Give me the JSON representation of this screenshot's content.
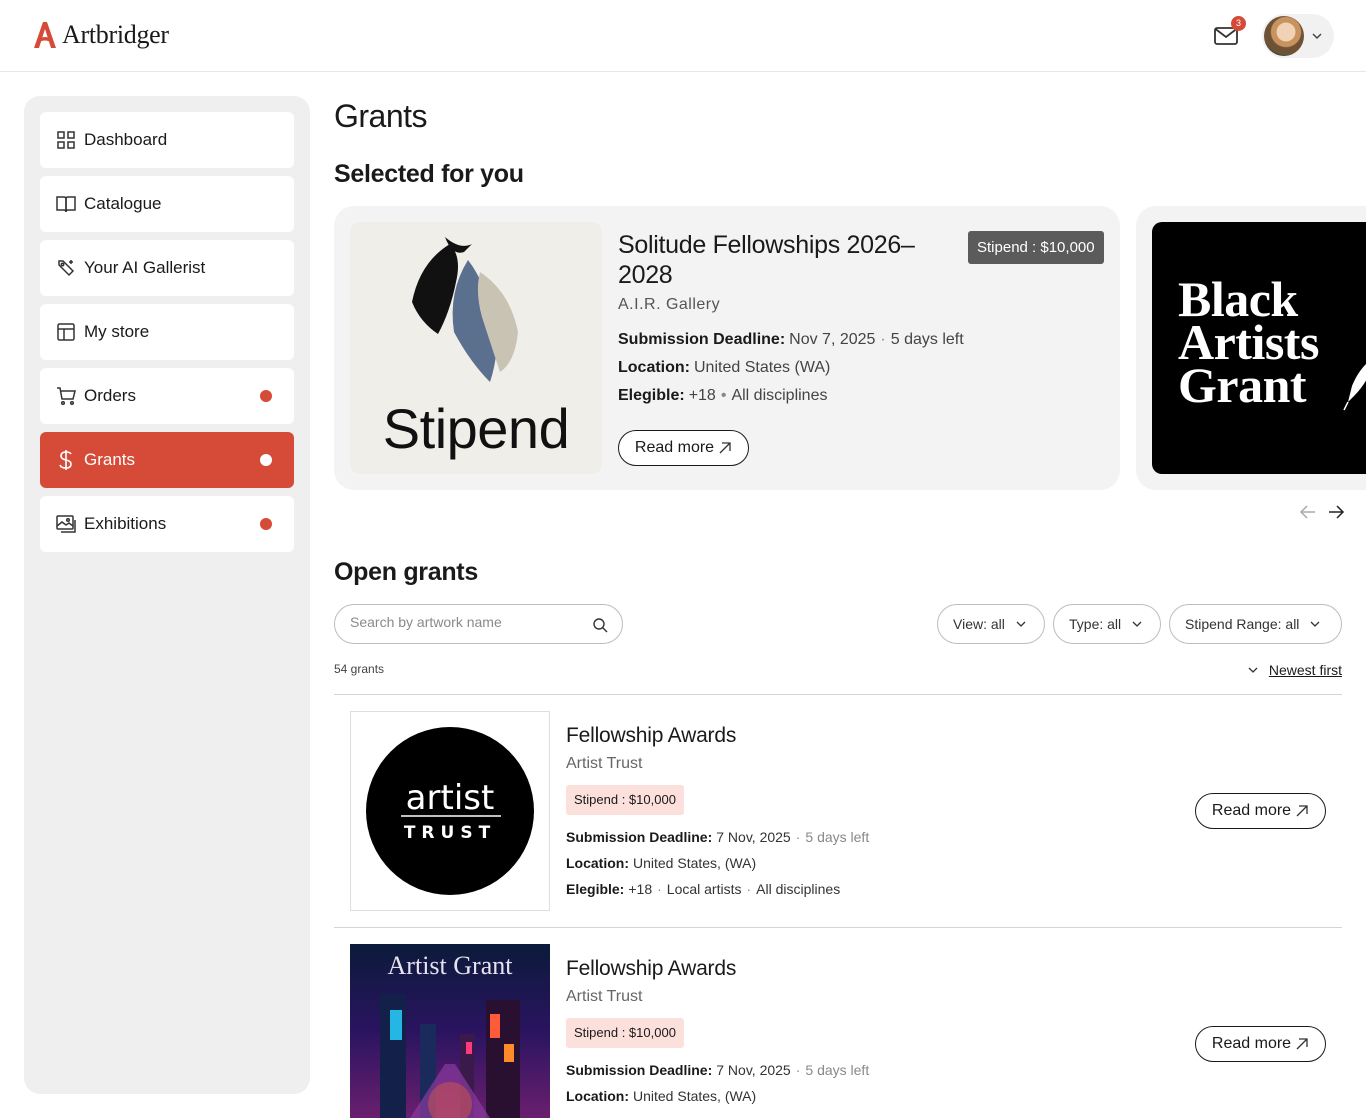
{
  "header": {
    "brand": "Artbridger",
    "notification_count": "3",
    "colors": {
      "accent": "#d64b38"
    }
  },
  "sidebar": {
    "items": [
      {
        "label": "Dashboard",
        "icon": "grid-icon"
      },
      {
        "label": "Catalogue",
        "icon": "book-icon"
      },
      {
        "label": "Your AI Gallerist",
        "icon": "sparkle-tag-icon"
      },
      {
        "label": "My store",
        "icon": "store-layout-icon"
      },
      {
        "label": "Orders",
        "icon": "cart-icon",
        "has_dot": true
      },
      {
        "label": "Grants",
        "icon": "dollar-icon",
        "has_dot": true,
        "active": true
      },
      {
        "label": "Exhibitions",
        "icon": "image-gallery-icon",
        "has_dot": true
      }
    ]
  },
  "main": {
    "title": "Grants",
    "selected_title": "Selected for you",
    "featured": {
      "image_word": "Stipend",
      "title": "Solitude Fellowships 2026–2028",
      "badge": "Stipend : $10,000",
      "org": "A.I.R. Gallery",
      "deadline_label": "Submission Deadline:",
      "deadline_value": "Nov 7, 2025",
      "deadline_left": "5 days left",
      "location_label": "Location:",
      "location_value": "United States (WA)",
      "eligible_label": "Elegible:",
      "eligible_age": "+18",
      "eligible_disc": "All disciplines",
      "read_more": "Read more"
    },
    "featured_next": {
      "image_line1": "Black",
      "image_line2": "Artists",
      "image_line3": "Grant"
    },
    "open_title": "Open grants",
    "search": {
      "placeholder": "Search by artwork name"
    },
    "filters": {
      "view": "View: all",
      "type": "Type: all",
      "stipend": "Stipend Range: all"
    },
    "count": "54 grants",
    "sort": "Newest first",
    "grants": [
      {
        "image_line1": "artist",
        "image_line2": "TRUST",
        "title": "Fellowship Awards",
        "org": "Artist Trust",
        "badge": "Stipend : $10,000",
        "deadline_label": "Submission Deadline:",
        "deadline_value": "7 Nov, 2025",
        "deadline_left": "5 days left",
        "location_label": "Location:",
        "location_value": "United States, (WA)",
        "eligible_label": "Elegible:",
        "eligible_age": "+18",
        "eligible_local": "Local artists",
        "eligible_disc": "All disciplines",
        "read_more": "Read more"
      },
      {
        "image_title": "Artist Grant",
        "title": "Fellowship Awards",
        "org": "Artist Trust",
        "badge": "Stipend : $10,000",
        "deadline_label": "Submission Deadline:",
        "deadline_value": "7 Nov, 2025",
        "deadline_left": "5 days left",
        "location_label": "Location:",
        "location_value": "United States, (WA)",
        "read_more": "Read more"
      }
    ]
  }
}
